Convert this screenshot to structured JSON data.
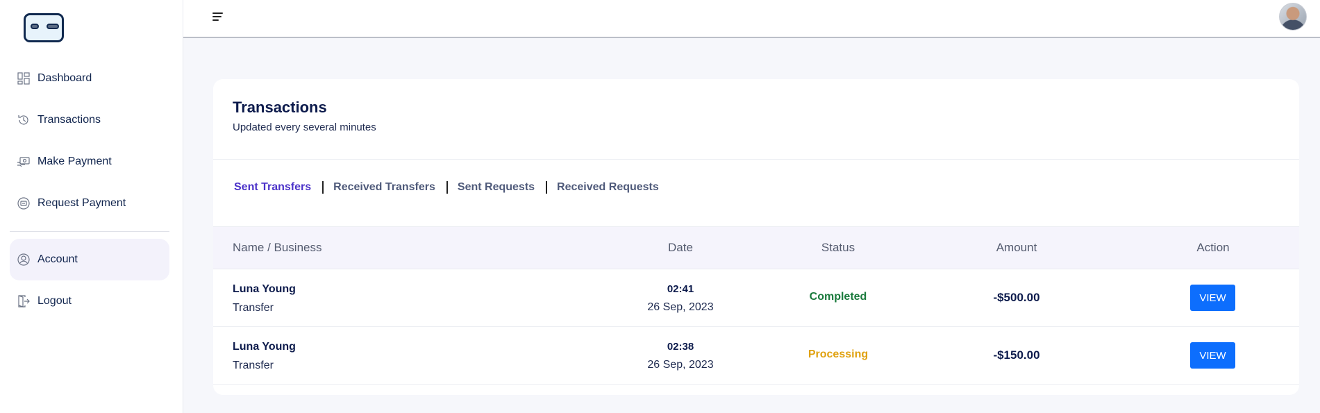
{
  "sidebar": {
    "items": [
      {
        "label": "Dashboard",
        "icon": "dashboard-icon"
      },
      {
        "label": "Transactions",
        "icon": "history-icon"
      },
      {
        "label": "Make Payment",
        "icon": "payment-icon"
      },
      {
        "label": "Request Payment",
        "icon": "request-payment-icon"
      },
      {
        "label": "Account",
        "icon": "user-icon",
        "active": true
      },
      {
        "label": "Logout",
        "icon": "logout-icon"
      }
    ]
  },
  "card": {
    "title": "Transactions",
    "subtitle": "Updated every several minutes"
  },
  "tabs": [
    "Sent Transfers",
    "Received Transfers",
    "Sent Requests",
    "Received Requests"
  ],
  "table": {
    "headers": [
      "Name / Business",
      "Date",
      "Status",
      "Amount",
      "Action"
    ],
    "rows": [
      {
        "name": "Luna Young",
        "type": "Transfer",
        "time": "02:41",
        "date": "26 Sep, 2023",
        "status": "Completed",
        "amount": "-$500.00",
        "action": "VIEW"
      },
      {
        "name": "Luna Young",
        "type": "Transfer",
        "time": "02:38",
        "date": "26 Sep, 2023",
        "status": "Processing",
        "amount": "-$150.00",
        "action": "VIEW"
      }
    ]
  },
  "colors": {
    "accent": "#4b32c9",
    "primary_button": "#0d6efd",
    "status_completed": "#1a7a3c",
    "status_processing": "#e0a211"
  }
}
